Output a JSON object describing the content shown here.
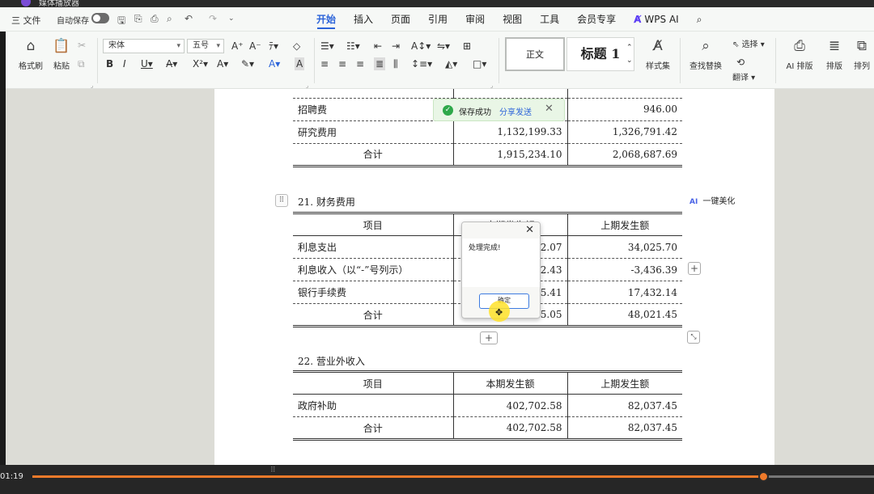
{
  "player": {
    "window_title": "媒体播放器",
    "elapsed": "01:19",
    "progress": 0.868
  },
  "menubar": {
    "file": "三 文件",
    "autosave": "自动保存",
    "tabs": [
      "开始",
      "插入",
      "页面",
      "引用",
      "审阅",
      "视图",
      "工具",
      "会员专享",
      "WPS AI"
    ],
    "active_tab": "开始"
  },
  "ribbon": {
    "format_painter": "格式刷",
    "paste": "粘贴",
    "font_name": "宋体",
    "font_size": "五号",
    "style_normal": "正文",
    "style_heading": "标题 1",
    "style_set": "样式集",
    "find_replace": "查找替换",
    "select": "选择",
    "translate": "翻译",
    "ai_layout": "AI 排版",
    "layout": "排版",
    "arrange": "排列"
  },
  "toast": {
    "message": "保存成功",
    "share": "分享发送"
  },
  "dialog": {
    "message": "处理完成!",
    "ok": "确定"
  },
  "ai_beautify": "一键美化",
  "table_top": {
    "rows": [
      {
        "item": "招聘费",
        "current": "",
        "previous": "946.00"
      },
      {
        "item": "研究费用",
        "current": "1,132,199.33",
        "previous": "1,326,791.42"
      },
      {
        "item": "合计",
        "current": "1,915,234.10",
        "previous": "2,068,687.69"
      }
    ]
  },
  "section21": {
    "title": "21.  财务费用",
    "headers": [
      "项目",
      "本期发生额",
      "上期发生额"
    ],
    "rows": [
      {
        "item": "利息支出",
        "current": "52.07",
        "previous": "34,025.70"
      },
      {
        "item": "利息收入（以“-”号列示）",
        "current": "52.43",
        "previous": "-3,436.39"
      },
      {
        "item": "银行手续费",
        "current": "35.41",
        "previous": "17,432.14"
      },
      {
        "item": "合计",
        "current": "95.05",
        "previous": "48,021.45"
      }
    ]
  },
  "section22": {
    "title": "22.  营业外收入",
    "headers": [
      "项目",
      "本期发生额",
      "上期发生额"
    ],
    "rows": [
      {
        "item": "政府补助",
        "current": "402,702.58",
        "previous": "82,037.45"
      },
      {
        "item": "合计",
        "current": "402,702.58",
        "previous": "82,037.45"
      }
    ]
  }
}
